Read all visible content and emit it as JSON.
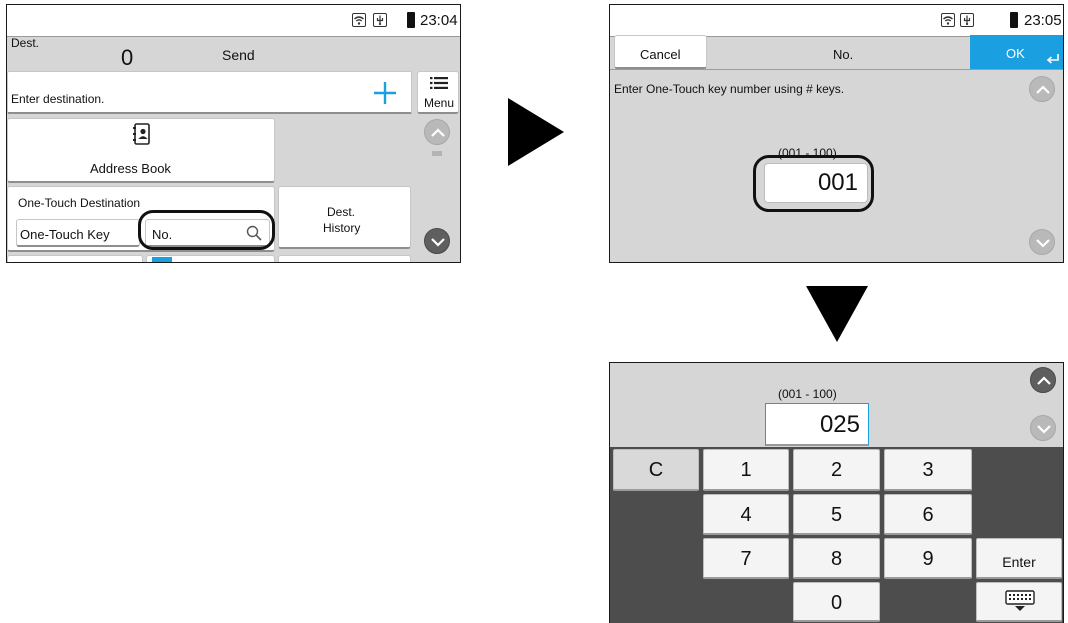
{
  "panel1": {
    "time": "23:04",
    "dest_label": "Dest.",
    "dest_count": "0",
    "send_label": "Send",
    "destination_placeholder": "Enter destination.",
    "menu_label": "Menu",
    "address_book_label": "Address Book",
    "one_touch_title": "One-Touch Destination",
    "one_touch_key_label": "One-Touch Key",
    "no_search_label": "No.",
    "dest_history_line1": "Dest.",
    "dest_history_line2": "History"
  },
  "panel2": {
    "time": "23:05",
    "cancel_label": "Cancel",
    "title": "No.",
    "ok_label": "OK",
    "instruction": "Enter One-Touch key number using # keys.",
    "range": "(001 - 100)",
    "value": "001"
  },
  "panel3": {
    "range": "(001 - 100)",
    "value": "025",
    "keys": {
      "clear": "C",
      "k1": "1",
      "k2": "2",
      "k3": "3",
      "k4": "4",
      "k5": "5",
      "k6": "6",
      "k7": "7",
      "k8": "8",
      "k9": "9",
      "k0": "0",
      "enter": "Enter"
    }
  },
  "colors": {
    "accent_blue": "#1a9fe0",
    "panel_gray": "#d6d6d6",
    "keypad_dark": "#4d4d4d"
  }
}
